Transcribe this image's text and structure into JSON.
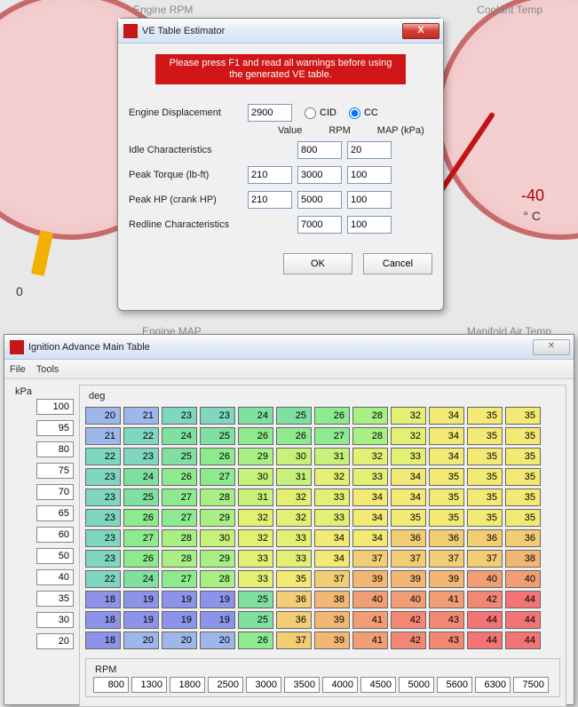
{
  "bg": {
    "rpm_label": "Engine RPM",
    "coolant_label": "Coolant Temp",
    "zero": "0",
    "temp": "-40",
    "temp_unit": "° C",
    "engine_map": "Engine MAP",
    "manifold": "Manifold Air Temp"
  },
  "ve": {
    "title": "VE Table Estimator",
    "warning": "Please press F1 and read all warnings before using the generated VE table.",
    "disp_label": "Engine Displacement",
    "disp_value": "2900",
    "unit_cid": "CID",
    "unit_cc": "CC",
    "col_value": "Value",
    "col_rpm": "RPM",
    "col_map": "MAP (kPa)",
    "rows": {
      "idle": {
        "label": "Idle Characteristics",
        "value": "",
        "rpm": "800",
        "map": "20"
      },
      "torque": {
        "label": "Peak Torque (lb-ft)",
        "value": "210",
        "rpm": "3000",
        "map": "100"
      },
      "hp": {
        "label": "Peak HP (crank HP)",
        "value": "210",
        "rpm": "5000",
        "map": "100"
      },
      "redline": {
        "label": "Redline Characteristics",
        "value": "",
        "rpm": "7000",
        "map": "100"
      }
    },
    "ok": "OK",
    "cancel": "Cancel"
  },
  "ign": {
    "title": "Ignition Advance Main Table",
    "menu_file": "File",
    "menu_tools": "Tools",
    "kpa_label": "kPa",
    "deg_label": "deg",
    "rpm_label": "RPM",
    "kpa": [
      "100",
      "95",
      "80",
      "75",
      "70",
      "65",
      "60",
      "50",
      "40",
      "35",
      "30",
      "20"
    ],
    "rpm": [
      "800",
      "1300",
      "1800",
      "2500",
      "3000",
      "3500",
      "4000",
      "4500",
      "5000",
      "5600",
      "6300",
      "7500"
    ],
    "grid": [
      [
        20,
        21,
        23,
        23,
        24,
        25,
        26,
        28,
        32,
        34,
        35,
        35
      ],
      [
        21,
        22,
        24,
        25,
        26,
        26,
        27,
        28,
        32,
        34,
        35,
        35
      ],
      [
        22,
        23,
        25,
        26,
        29,
        30,
        31,
        32,
        33,
        34,
        35,
        35
      ],
      [
        23,
        24,
        26,
        27,
        30,
        31,
        32,
        33,
        34,
        35,
        35,
        35
      ],
      [
        23,
        25,
        27,
        28,
        31,
        32,
        33,
        34,
        34,
        35,
        35,
        35
      ],
      [
        23,
        26,
        27,
        29,
        32,
        32,
        33,
        34,
        35,
        35,
        35,
        35
      ],
      [
        23,
        27,
        28,
        30,
        32,
        33,
        34,
        34,
        36,
        36,
        36,
        36
      ],
      [
        23,
        26,
        28,
        29,
        33,
        33,
        34,
        37,
        37,
        37,
        37,
        38
      ],
      [
        22,
        24,
        27,
        28,
        33,
        35,
        37,
        39,
        39,
        39,
        40,
        40
      ],
      [
        18,
        19,
        19,
        19,
        25,
        36,
        38,
        40,
        40,
        41,
        42,
        44
      ],
      [
        18,
        19,
        19,
        19,
        25,
        36,
        39,
        41,
        42,
        43,
        44,
        44
      ],
      [
        18,
        20,
        20,
        20,
        26,
        37,
        39,
        41,
        42,
        43,
        44,
        44
      ]
    ]
  },
  "chart_data": {
    "type": "heatmap",
    "title": "Ignition Advance Main Table",
    "xlabel": "RPM",
    "ylabel": "kPa",
    "value_label": "deg",
    "x": [
      800,
      1300,
      1800,
      2500,
      3000,
      3500,
      4000,
      4500,
      5000,
      5600,
      6300,
      7500
    ],
    "y": [
      100,
      95,
      80,
      75,
      70,
      65,
      60,
      50,
      40,
      35,
      30,
      20
    ],
    "z": [
      [
        20,
        21,
        23,
        23,
        24,
        25,
        26,
        28,
        32,
        34,
        35,
        35
      ],
      [
        21,
        22,
        24,
        25,
        26,
        26,
        27,
        28,
        32,
        34,
        35,
        35
      ],
      [
        22,
        23,
        25,
        26,
        29,
        30,
        31,
        32,
        33,
        34,
        35,
        35
      ],
      [
        23,
        24,
        26,
        27,
        30,
        31,
        32,
        33,
        34,
        35,
        35,
        35
      ],
      [
        23,
        25,
        27,
        28,
        31,
        32,
        33,
        34,
        34,
        35,
        35,
        35
      ],
      [
        23,
        26,
        27,
        29,
        32,
        32,
        33,
        34,
        35,
        35,
        35,
        35
      ],
      [
        23,
        27,
        28,
        30,
        32,
        33,
        34,
        34,
        36,
        36,
        36,
        36
      ],
      [
        23,
        26,
        28,
        29,
        33,
        33,
        34,
        37,
        37,
        37,
        37,
        38
      ],
      [
        22,
        24,
        27,
        28,
        33,
        35,
        37,
        39,
        39,
        39,
        40,
        40
      ],
      [
        18,
        19,
        19,
        19,
        25,
        36,
        38,
        40,
        40,
        41,
        42,
        44
      ],
      [
        18,
        19,
        19,
        19,
        25,
        36,
        39,
        41,
        42,
        43,
        44,
        44
      ],
      [
        18,
        20,
        20,
        20,
        26,
        37,
        39,
        41,
        42,
        43,
        44,
        44
      ]
    ]
  }
}
